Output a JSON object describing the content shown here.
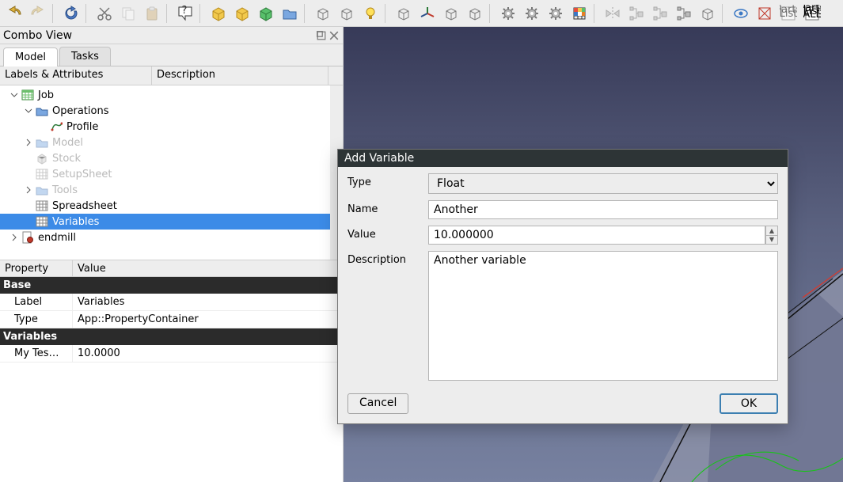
{
  "toolbar_icons": [
    "undo",
    "redo",
    "sep",
    "refresh",
    "sep",
    "cut",
    "copy",
    "paste",
    "sep",
    "whatsthis",
    "sep",
    "box-yellow",
    "box-yellow2",
    "box-green",
    "folder",
    "sep",
    "boxwire1",
    "boxwire2",
    "bulb",
    "sep",
    "boxdash",
    "axes",
    "boxpersp",
    "boxshift",
    "sep",
    "gear1",
    "gear2",
    "gear3",
    "rubik",
    "sep",
    "mirror",
    "tree1",
    "tree2",
    "treebox",
    "boxstack",
    "sep",
    "eye",
    "crossbox",
    "partslist",
    "partslistall"
  ],
  "combo": {
    "title": "Combo View",
    "tabs": {
      "model": "Model",
      "tasks": "Tasks"
    },
    "headers": {
      "labels": "Labels & Attributes",
      "desc": "Description"
    }
  },
  "tree": {
    "items": [
      {
        "id": "job",
        "label": "Job",
        "depth": 0,
        "exp": "open",
        "icon": "sheet",
        "faded": false
      },
      {
        "id": "operations",
        "label": "Operations",
        "depth": 1,
        "exp": "open",
        "icon": "folder",
        "faded": false
      },
      {
        "id": "profile",
        "label": "Profile",
        "depth": 2,
        "exp": "none",
        "icon": "profile",
        "faded": false
      },
      {
        "id": "model",
        "label": "Model",
        "depth": 1,
        "exp": "closed",
        "icon": "folder",
        "faded": true
      },
      {
        "id": "stock",
        "label": "Stock",
        "depth": 1,
        "exp": "none",
        "icon": "box",
        "faded": true
      },
      {
        "id": "setupsheet",
        "label": "SetupSheet",
        "depth": 1,
        "exp": "none",
        "icon": "grid",
        "faded": true
      },
      {
        "id": "tools",
        "label": "Tools",
        "depth": 1,
        "exp": "closed",
        "icon": "folder",
        "faded": true
      },
      {
        "id": "spreadsheet",
        "label": "Spreadsheet",
        "depth": 1,
        "exp": "none",
        "icon": "grid",
        "faded": false
      },
      {
        "id": "variables",
        "label": "Variables",
        "depth": 1,
        "exp": "none",
        "icon": "grid",
        "faded": false,
        "selected": true
      },
      {
        "id": "endmill",
        "label": "endmill",
        "depth": 0,
        "exp": "closed",
        "icon": "doc",
        "faded": false
      }
    ]
  },
  "props": {
    "headers": {
      "prop": "Property",
      "val": "Value"
    },
    "group_base": "Base",
    "rows_base": [
      {
        "k": "Label",
        "v": "Variables"
      },
      {
        "k": "Type",
        "v": "App::PropertyContainer"
      }
    ],
    "group_vars": "Variables",
    "rows_vars": [
      {
        "k": "My Tes…",
        "v": "10.0000"
      }
    ]
  },
  "dialog": {
    "title": "Add Variable",
    "labels": {
      "type": "Type",
      "name": "Name",
      "value": "Value",
      "desc": "Description"
    },
    "values": {
      "type": "Float",
      "name": "Another",
      "value": "10.000000",
      "desc": "Another variable"
    },
    "buttons": {
      "cancel": "Cancel",
      "ok": "OK"
    }
  }
}
